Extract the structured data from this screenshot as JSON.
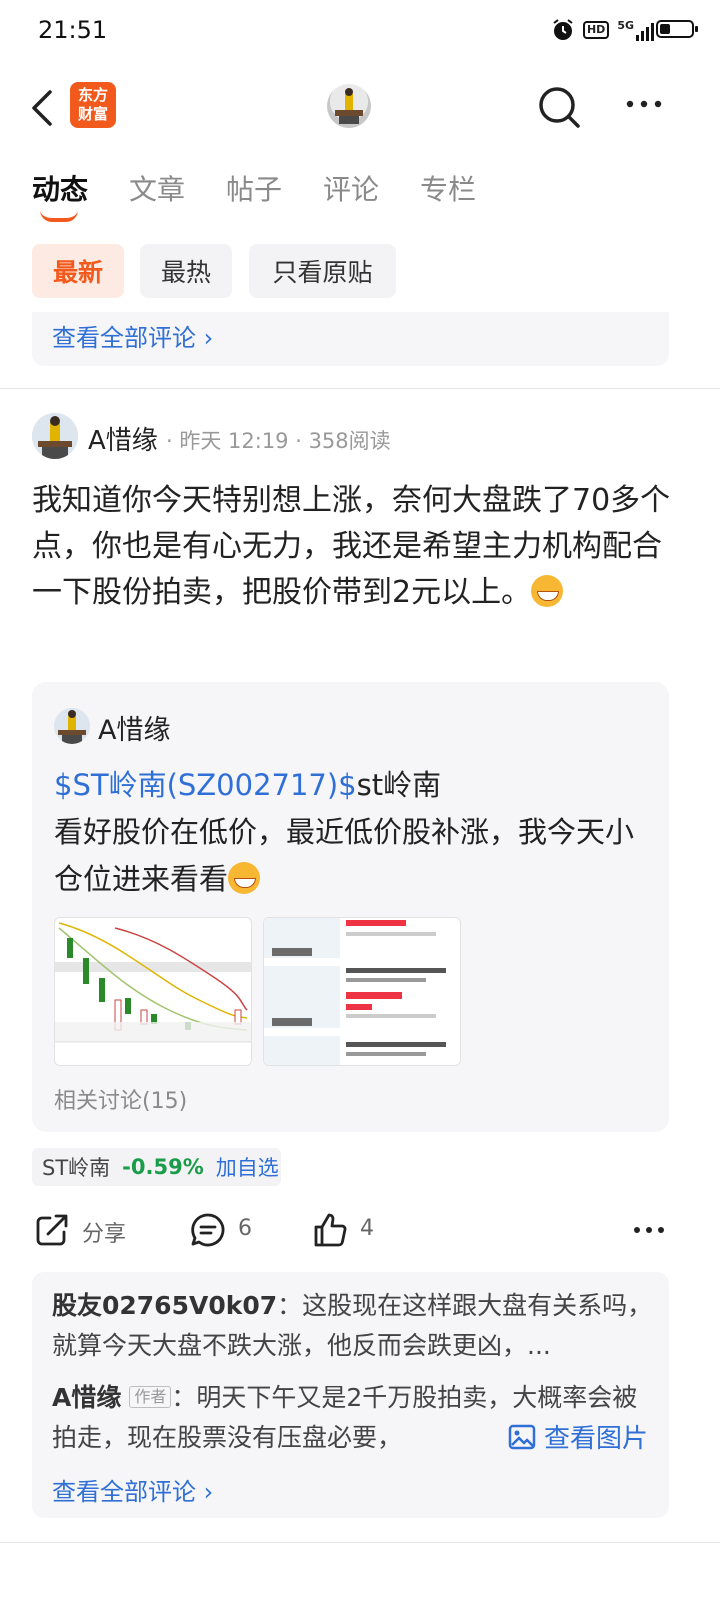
{
  "status_bar": {
    "time": "21:51",
    "hd_label": "HD",
    "network_label": "5G"
  },
  "header": {
    "logo_line1": "东方",
    "logo_line2": "财富",
    "brand_color": "#f25a1d"
  },
  "tabs": [
    {
      "label": "动态",
      "active": true
    },
    {
      "label": "文章",
      "active": false
    },
    {
      "label": "帖子",
      "active": false
    },
    {
      "label": "评论",
      "active": false
    },
    {
      "label": "专栏",
      "active": false
    }
  ],
  "filters": [
    {
      "label": "最新",
      "active": true
    },
    {
      "label": "最热",
      "active": false
    },
    {
      "label": "只看原贴",
      "active": false
    }
  ],
  "prev_post": {
    "view_all_comments": "查看全部评论 ›"
  },
  "post": {
    "user": "A惜缘",
    "meta": "· 昨天 12:19 · 358阅读",
    "text": "我知道你今天特别想上涨，奈何大盘跌了70多个点，你也是有心无力，我还是希望主力机构配合一下股份拍卖，把股价带到2元以上。",
    "emoji_icon": "grin-emoji",
    "quote": {
      "user": "A惜缘",
      "stock_link": "$ST岭南(SZ002717)$",
      "text_after_link": "st岭南",
      "text_body": "看好股价在低价，最近低价股补涨，我今天小仓位进来看看",
      "related": "相关讨论(15)"
    },
    "stock_tag": {
      "name": "ST岭南",
      "change": "-0.59%",
      "add": "加自选"
    },
    "actions": {
      "share": "分享",
      "comments": "6",
      "likes": "4"
    },
    "comments": [
      {
        "name": "股友02765V0k07",
        "text": "：这股现在这样跟大盘有关系吗，就算今天大盘不跌大涨，他反而会跌更凶，..."
      },
      {
        "name": "A惜缘",
        "badge": "作者",
        "text": "：明天下午又是2千万股拍卖，大概率会被拍走，现在股票没有压盘必要，"
      }
    ],
    "view_image": "查看图片",
    "view_all_comments": "查看全部评论 ›"
  }
}
